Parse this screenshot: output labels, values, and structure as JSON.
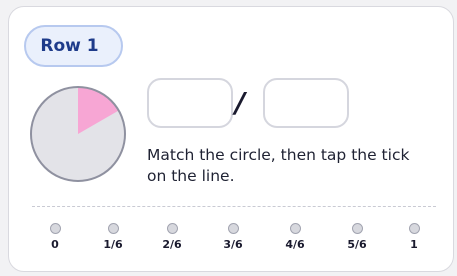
{
  "row_badge": {
    "label": "Row 1"
  },
  "circle": {
    "shaded_fraction": "1/6",
    "shaded_color": "#f7a6d4",
    "unshaded_color": "#e3e3e8",
    "outline_color": "#8f91a0"
  },
  "fraction_input": {
    "numerator_value": "",
    "denominator_value": "",
    "separator": "/"
  },
  "instruction": "Match the circle, then tap the tick on the line.",
  "number_line": {
    "ticks": [
      "0",
      "1/6",
      "2/6",
      "3/6",
      "4/6",
      "5/6",
      "1"
    ]
  },
  "colors": {
    "badge_text": "#1e3b8a",
    "badge_bg": "#eaf0fc",
    "badge_border": "#b7c9ef"
  }
}
